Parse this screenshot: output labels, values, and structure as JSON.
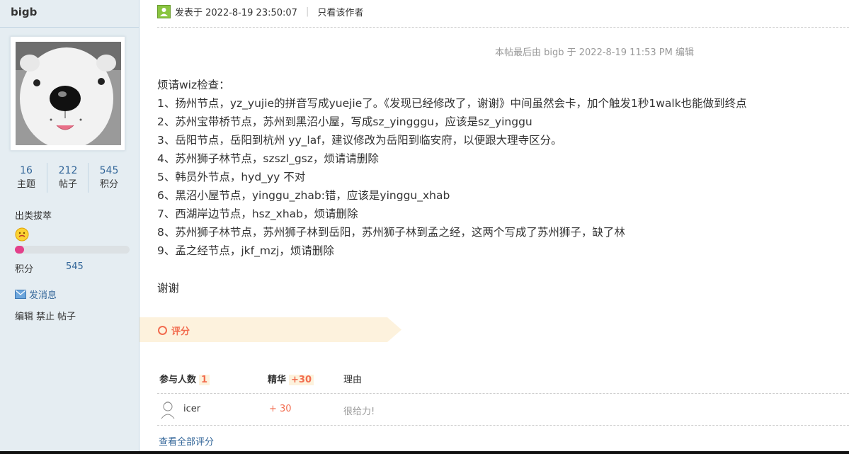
{
  "author": {
    "name": "bigb",
    "stats": [
      {
        "value": "16",
        "label": "主题"
      },
      {
        "value": "212",
        "label": "帖子"
      },
      {
        "value": "545",
        "label": "积分"
      }
    ],
    "group": "出类拔萃",
    "credit_label": "积分",
    "credit_value": "545",
    "credit_progress_percent": 8,
    "pm_label": "发消息",
    "admin_links": [
      "编辑",
      "禁止",
      "帖子"
    ]
  },
  "post": {
    "posted_at": "发表于 2022-8-19 23:50:07",
    "only_author": "只看该作者",
    "edit_note": "本帖最后由 bigb 于 2022-8-19 11:53 PM 编辑",
    "lines": [
      "烦请wiz检查：",
      "1、扬州节点，yz_yujie的拼音写成yuejie了。《发现已经修改了，谢谢》中间虽然会卡，加个触发1秒1walk也能做到终点",
      "2、苏州宝带桥节点，苏州到黑沼小屋，写成sz_yingggu，应该是sz_yinggu",
      "3、岳阳节点，岳阳到杭州 yy_laf，建议修改为岳阳到临安府，以便跟大理寺区分。",
      "4、苏州狮子林节点，szszl_gsz，烦请请删除",
      "5、韩员外节点，hyd_yy 不对",
      "6、黑沼小屋节点，yinggu_zhab:错，应该是yinggu_xhab",
      "7、西湖岸边节点，hsz_xhab，烦请删除",
      "8、苏州狮子林节点，苏州狮子林到岳阳，苏州狮子林到孟之经，这两个写成了苏州狮子，缺了林",
      "9、孟之经节点，jkf_mzj，烦请删除"
    ],
    "thanks": "谢谢"
  },
  "rating": {
    "title": "评分",
    "participants_label": "参与人数",
    "participants_count": "1",
    "essence_label": "精华",
    "essence_total": "+30",
    "reason_label": "理由",
    "entries": [
      {
        "user": "icer",
        "score": "+ 30",
        "reason": "很给力!"
      }
    ],
    "view_all": "查看全部评分"
  },
  "colors": {
    "sidebar_bg": "#e5edf2",
    "link": "#336699",
    "accent": "#f26c4f",
    "progress": "#e3408a"
  }
}
